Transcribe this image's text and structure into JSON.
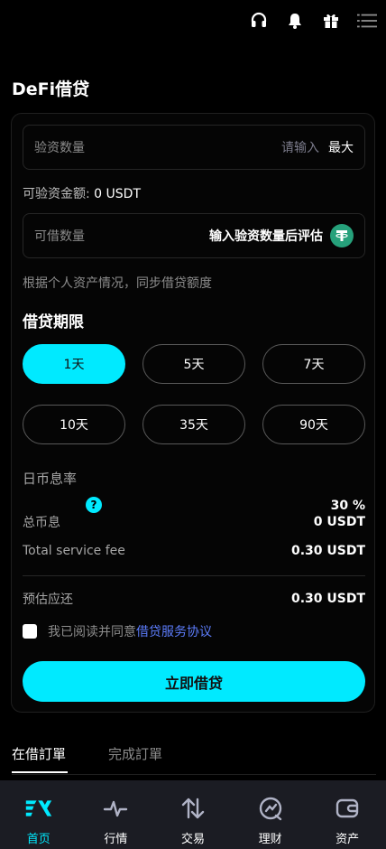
{
  "header": {
    "icons": [
      "headset-icon",
      "bell-icon",
      "gift-icon",
      "menu-icon"
    ]
  },
  "page": {
    "title": "DeFi借贷"
  },
  "form": {
    "collateral": {
      "label": "验资数量",
      "placeholder": "请输入",
      "max_label": "最大"
    },
    "available": {
      "label": "可验资金额:",
      "value": "0 USDT"
    },
    "borrow": {
      "label": "可借数量",
      "estimate": "输入验资数量后评估"
    },
    "note": "根据个人资产情况，同步借贷额度",
    "term_title": "借贷期限",
    "terms": [
      {
        "label": "1天",
        "selected": true
      },
      {
        "label": "5天"
      },
      {
        "label": "7天"
      },
      {
        "label": "10天"
      },
      {
        "label": "35天"
      },
      {
        "label": "90天"
      }
    ],
    "rate": {
      "label": "日币息率",
      "help": "?",
      "value": "30 %"
    },
    "total_interest": {
      "label": "总币息",
      "value": "0 USDT"
    },
    "service_fee": {
      "label": "Total service fee",
      "value": "0.30 USDT"
    },
    "estimated_repay": {
      "label": "预估应还",
      "value": "0.30 USDT"
    },
    "agreement": {
      "text": "我已阅读并同意",
      "link": "借贷服务协议"
    },
    "submit_label": "立即借贷"
  },
  "order_tabs": [
    {
      "label": "在借訂單",
      "active": true
    },
    {
      "label": "完成訂單",
      "active": false
    }
  ],
  "bottom_nav": [
    {
      "label": "首页",
      "icon": "home-logo-icon",
      "active": true
    },
    {
      "label": "行情",
      "icon": "pulse-icon"
    },
    {
      "label": "交易",
      "icon": "swap-arrows-icon"
    },
    {
      "label": "理财",
      "icon": "finance-icon"
    },
    {
      "label": "资产",
      "icon": "wallet-icon"
    }
  ],
  "colors": {
    "accent": "#00eaff",
    "link": "#5c7cfa",
    "tether": "#26a17b",
    "nav_bg": "#1b1c23"
  }
}
